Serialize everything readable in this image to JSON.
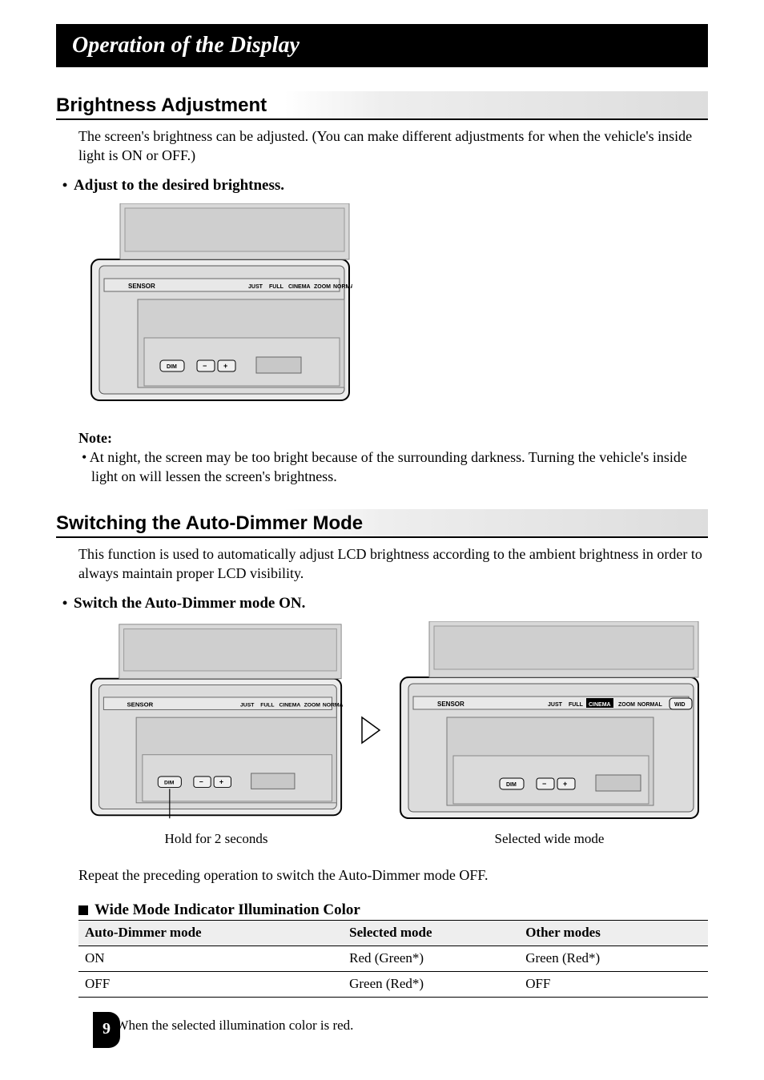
{
  "title_bar": "Operation of the Display",
  "brightness": {
    "heading": "Brightness Adjustment",
    "intro": "The screen's brightness can be adjusted. (You can make different adjustments for when the vehicle's inside light is ON or OFF.)",
    "bullet": "Adjust to the desired brightness."
  },
  "device_labels": {
    "sensor": "SENSOR",
    "just": "JUST",
    "full": "FULL",
    "cinema": "CINEMA",
    "zoom": "ZOOM",
    "normal": "NORMAL",
    "norma": "NORMA",
    "wid": "WID",
    "dim": "DIM",
    "minus": "−",
    "plus": "+"
  },
  "note": {
    "heading": "Note:",
    "body": "•  At night, the screen may be too bright because of the surrounding darkness. Turning the vehicle's inside light on will lessen the screen's brightness."
  },
  "autodimmer": {
    "heading": "Switching the Auto-Dimmer Mode",
    "intro": "This function is used to automatically adjust LCD brightness according to the ambient brightness in order to always maintain proper LCD visibility.",
    "bullet": "Switch the Auto-Dimmer mode ON.",
    "caption_left": "Hold for 2 seconds",
    "caption_right": "Selected wide mode",
    "repeat": "Repeat the preceding operation to switch the Auto-Dimmer mode OFF."
  },
  "color_table": {
    "heading": "Wide Mode Indicator Illumination Color",
    "headers": [
      "Auto-Dimmer mode",
      "Selected mode",
      "Other modes"
    ],
    "rows": [
      [
        "ON",
        "Red (Green*)",
        "Green (Red*)"
      ],
      [
        "OFF",
        "Green (Red*)",
        "OFF"
      ]
    ]
  },
  "footnote": "When the selected illumination color is red.",
  "footnote_mark": "*",
  "page_number": "9"
}
